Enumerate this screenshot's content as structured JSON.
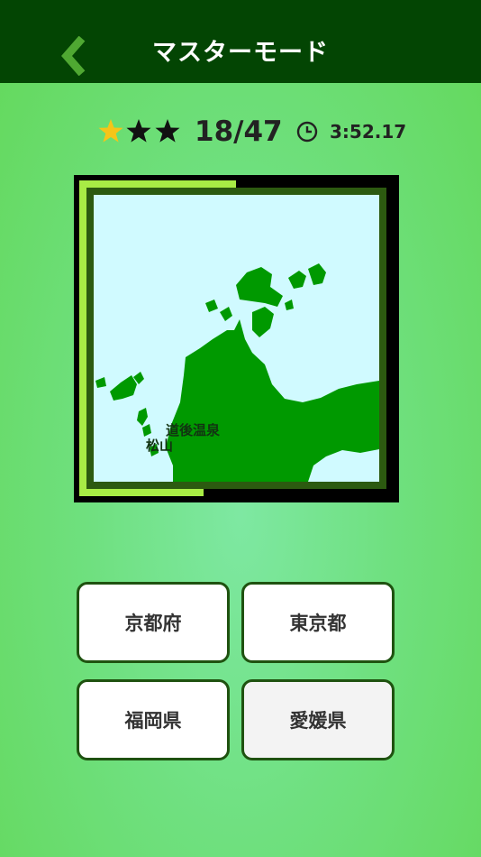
{
  "header": {
    "title": "マスターモード",
    "back_icon": "chevron-left-icon"
  },
  "status": {
    "stars_total": 3,
    "stars_earned": 1,
    "progress": "18/47",
    "time": "3:52.17",
    "clock_icon": "clock-icon"
  },
  "map": {
    "labels": {
      "onsen": "道後温泉",
      "city": "松山"
    },
    "colors": {
      "land": "#009900",
      "sea": "#d0faff"
    }
  },
  "answers": [
    {
      "label": "京都府"
    },
    {
      "label": "東京都"
    },
    {
      "label": "福岡県"
    },
    {
      "label": "愛媛県"
    }
  ],
  "colors": {
    "header_bg": "#034503",
    "accent": "#a8ec45",
    "star_gold": "#f5c518",
    "star_dark": "#111111"
  }
}
